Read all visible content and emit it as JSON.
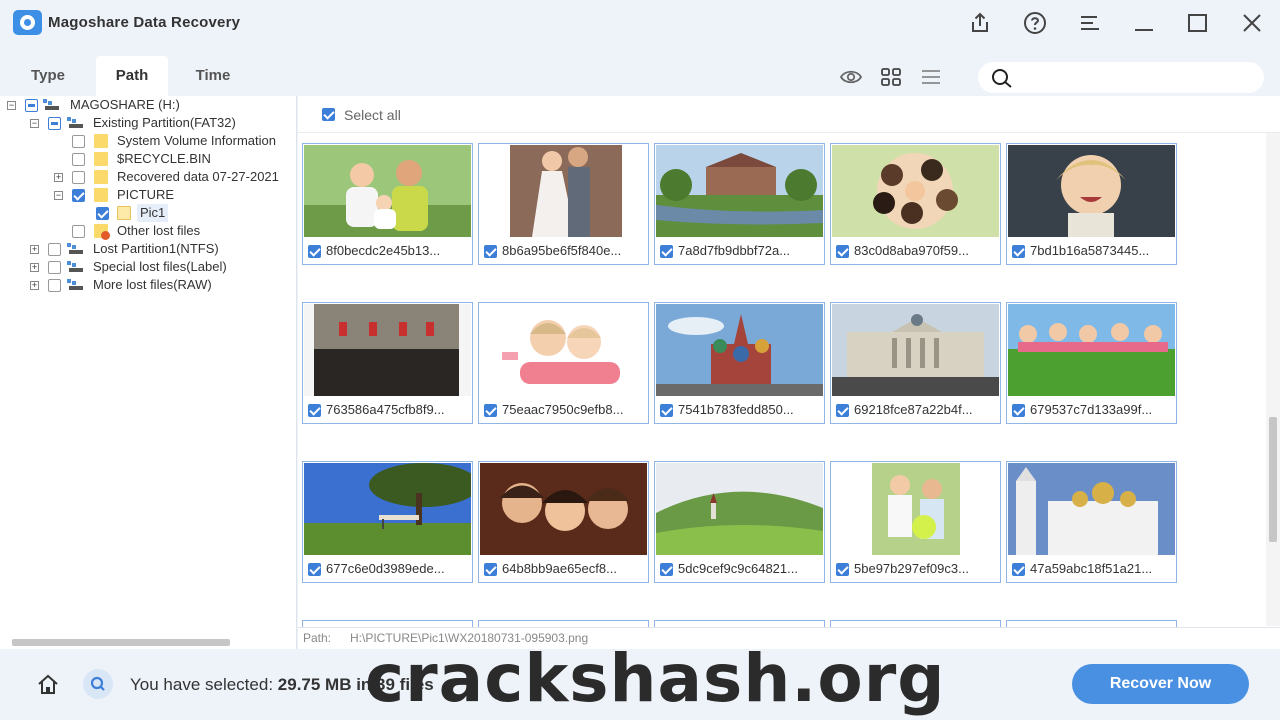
{
  "app": {
    "title": "Magoshare Data Recovery"
  },
  "tabs": [
    {
      "label": "Type",
      "active": false
    },
    {
      "label": "Path",
      "active": true
    },
    {
      "label": "Time",
      "active": false
    }
  ],
  "search": {
    "placeholder": ""
  },
  "tree": {
    "root": "MAGOSHARE (H:)",
    "existing": "Existing Partition(FAT32)",
    "svi": "System Volume Information",
    "recycle": "$RECYCLE.BIN",
    "recovered": "Recovered data 07-27-2021",
    "picture": "PICTURE",
    "pic1": "Pic1",
    "other": "Other lost files",
    "lost1": "Lost Partition1(NTFS)",
    "special": "Special lost files(Label)",
    "more": "More lost files(RAW)"
  },
  "content": {
    "select_all": "Select all",
    "files": [
      {
        "name": "8f0becdc2e45b13...",
        "scene": "family"
      },
      {
        "name": "8b6a95be6f5f840e...",
        "scene": "wedding"
      },
      {
        "name": "7a8d7fb9dbbf72a...",
        "scene": "house"
      },
      {
        "name": "83c0d8aba970f59...",
        "scene": "circle"
      },
      {
        "name": "7bd1b16a5873445...",
        "scene": "child"
      },
      {
        "name": "763586a475cfb8f9...",
        "scene": "horses"
      },
      {
        "name": "75eaac7950c9efb8...",
        "scene": "kids"
      },
      {
        "name": "7541b783fedd850...",
        "scene": "cathedral"
      },
      {
        "name": "69218fce87a22b4f...",
        "scene": "gallery"
      },
      {
        "name": "679537c7d133a99f...",
        "scene": "grass"
      },
      {
        "name": "677c6e0d3989ede...",
        "scene": "tree"
      },
      {
        "name": "64b8bb9ae65ecf8...",
        "scene": "trio"
      },
      {
        "name": "5dc9cef9c9c64821...",
        "scene": "valley"
      },
      {
        "name": "5be97b297ef09c3...",
        "scene": "boys"
      },
      {
        "name": "47a59abc18f51a21...",
        "scene": "church"
      }
    ]
  },
  "path": {
    "label": "Path:",
    "value": "H:\\PICTURE\\Pic1\\WX20180731-095903.png"
  },
  "bottom": {
    "selected_label": "You have selected:",
    "selected_value": "29.75 MB in 39 files",
    "recover_label": "Recover Now"
  },
  "watermark": "crackshash.org",
  "colors": {
    "accent": "#4a90e2",
    "checkbox": "#3d7fd8",
    "folder": "#fbd96b"
  }
}
